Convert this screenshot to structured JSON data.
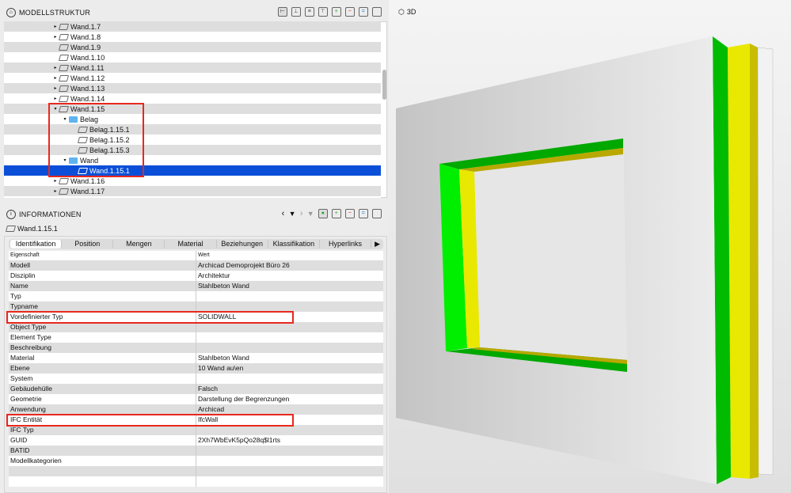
{
  "modellstruktur": {
    "title": "MODELLSTRUKTUR",
    "tree": [
      {
        "label": "Wand.1.7",
        "indent": 0,
        "toggle": "collapsed",
        "icon": "wall"
      },
      {
        "label": "Wand.1.8",
        "indent": 0,
        "toggle": "collapsed",
        "icon": "wall"
      },
      {
        "label": "Wand.1.9",
        "indent": 0,
        "toggle": "none",
        "icon": "wall"
      },
      {
        "label": "Wand.1.10",
        "indent": 0,
        "toggle": "none",
        "icon": "wall"
      },
      {
        "label": "Wand.1.11",
        "indent": 0,
        "toggle": "collapsed",
        "icon": "wall"
      },
      {
        "label": "Wand.1.12",
        "indent": 0,
        "toggle": "collapsed",
        "icon": "wall"
      },
      {
        "label": "Wand.1.13",
        "indent": 0,
        "toggle": "collapsed",
        "icon": "wall"
      },
      {
        "label": "Wand.1.14",
        "indent": 0,
        "toggle": "collapsed",
        "icon": "wall"
      },
      {
        "label": "Wand.1.15",
        "indent": 0,
        "toggle": "expanded",
        "icon": "wall"
      },
      {
        "label": "Belag",
        "indent": 1,
        "toggle": "expanded",
        "icon": "folder"
      },
      {
        "label": "Belag.1.15.1",
        "indent": 2,
        "toggle": "none",
        "icon": "layer"
      },
      {
        "label": "Belag.1.15.2",
        "indent": 2,
        "toggle": "none",
        "icon": "layer"
      },
      {
        "label": "Belag.1.15.3",
        "indent": 2,
        "toggle": "none",
        "icon": "layer"
      },
      {
        "label": "Wand",
        "indent": 1,
        "toggle": "expanded",
        "icon": "folder"
      },
      {
        "label": "Wand.1.15.1",
        "indent": 2,
        "toggle": "none",
        "icon": "wall",
        "selected": true
      },
      {
        "label": "Wand.1.16",
        "indent": 0,
        "toggle": "collapsed",
        "icon": "wall"
      },
      {
        "label": "Wand.1.17",
        "indent": 0,
        "toggle": "collapsed",
        "icon": "wall"
      }
    ]
  },
  "informationen": {
    "title": "INFORMATIONEN",
    "element": "Wand.1.15.1",
    "tabs": [
      "Identifikation",
      "Position",
      "Mengen",
      "Material",
      "Beziehungen",
      "Klassifikation",
      "Hyperlinks"
    ],
    "columns": [
      "Eigenschaft",
      "Wert"
    ],
    "rows": [
      [
        "Modell",
        "Archicad Demoprojekt Büro 26"
      ],
      [
        "Disziplin",
        "Architektur"
      ],
      [
        "Name",
        "Stahlbeton Wand"
      ],
      [
        "Typ",
        ""
      ],
      [
        "Typname",
        ""
      ],
      [
        "Vordefinierter Typ",
        "SOLIDWALL"
      ],
      [
        "Object Type",
        ""
      ],
      [
        "Element Type",
        ""
      ],
      [
        "Beschreibung",
        ""
      ],
      [
        "Material",
        "Stahlbeton Wand"
      ],
      [
        "Ebene",
        "10 Wand au\\en"
      ],
      [
        "System",
        ""
      ],
      [
        "Gebäudehülle",
        "Falsch"
      ],
      [
        "Geometrie",
        "Darstellung der Begrenzungen"
      ],
      [
        "Anwendung",
        "Archicad"
      ],
      [
        "IFC Entität",
        "IfcWall"
      ],
      [
        "IFC Typ",
        ""
      ],
      [
        "GUID",
        "2Xh7WbEvK5pQo28q$l1rts"
      ],
      [
        "BATID",
        ""
      ],
      [
        "Modellkategorien",
        ""
      ],
      [
        "",
        ""
      ],
      [
        "",
        ""
      ]
    ]
  },
  "view3d": {
    "title": "3D"
  },
  "colors": {
    "selection": "#0b4fd8",
    "highlight": "#e8281e",
    "green": "#00c000",
    "yellow": "#e8e800"
  }
}
